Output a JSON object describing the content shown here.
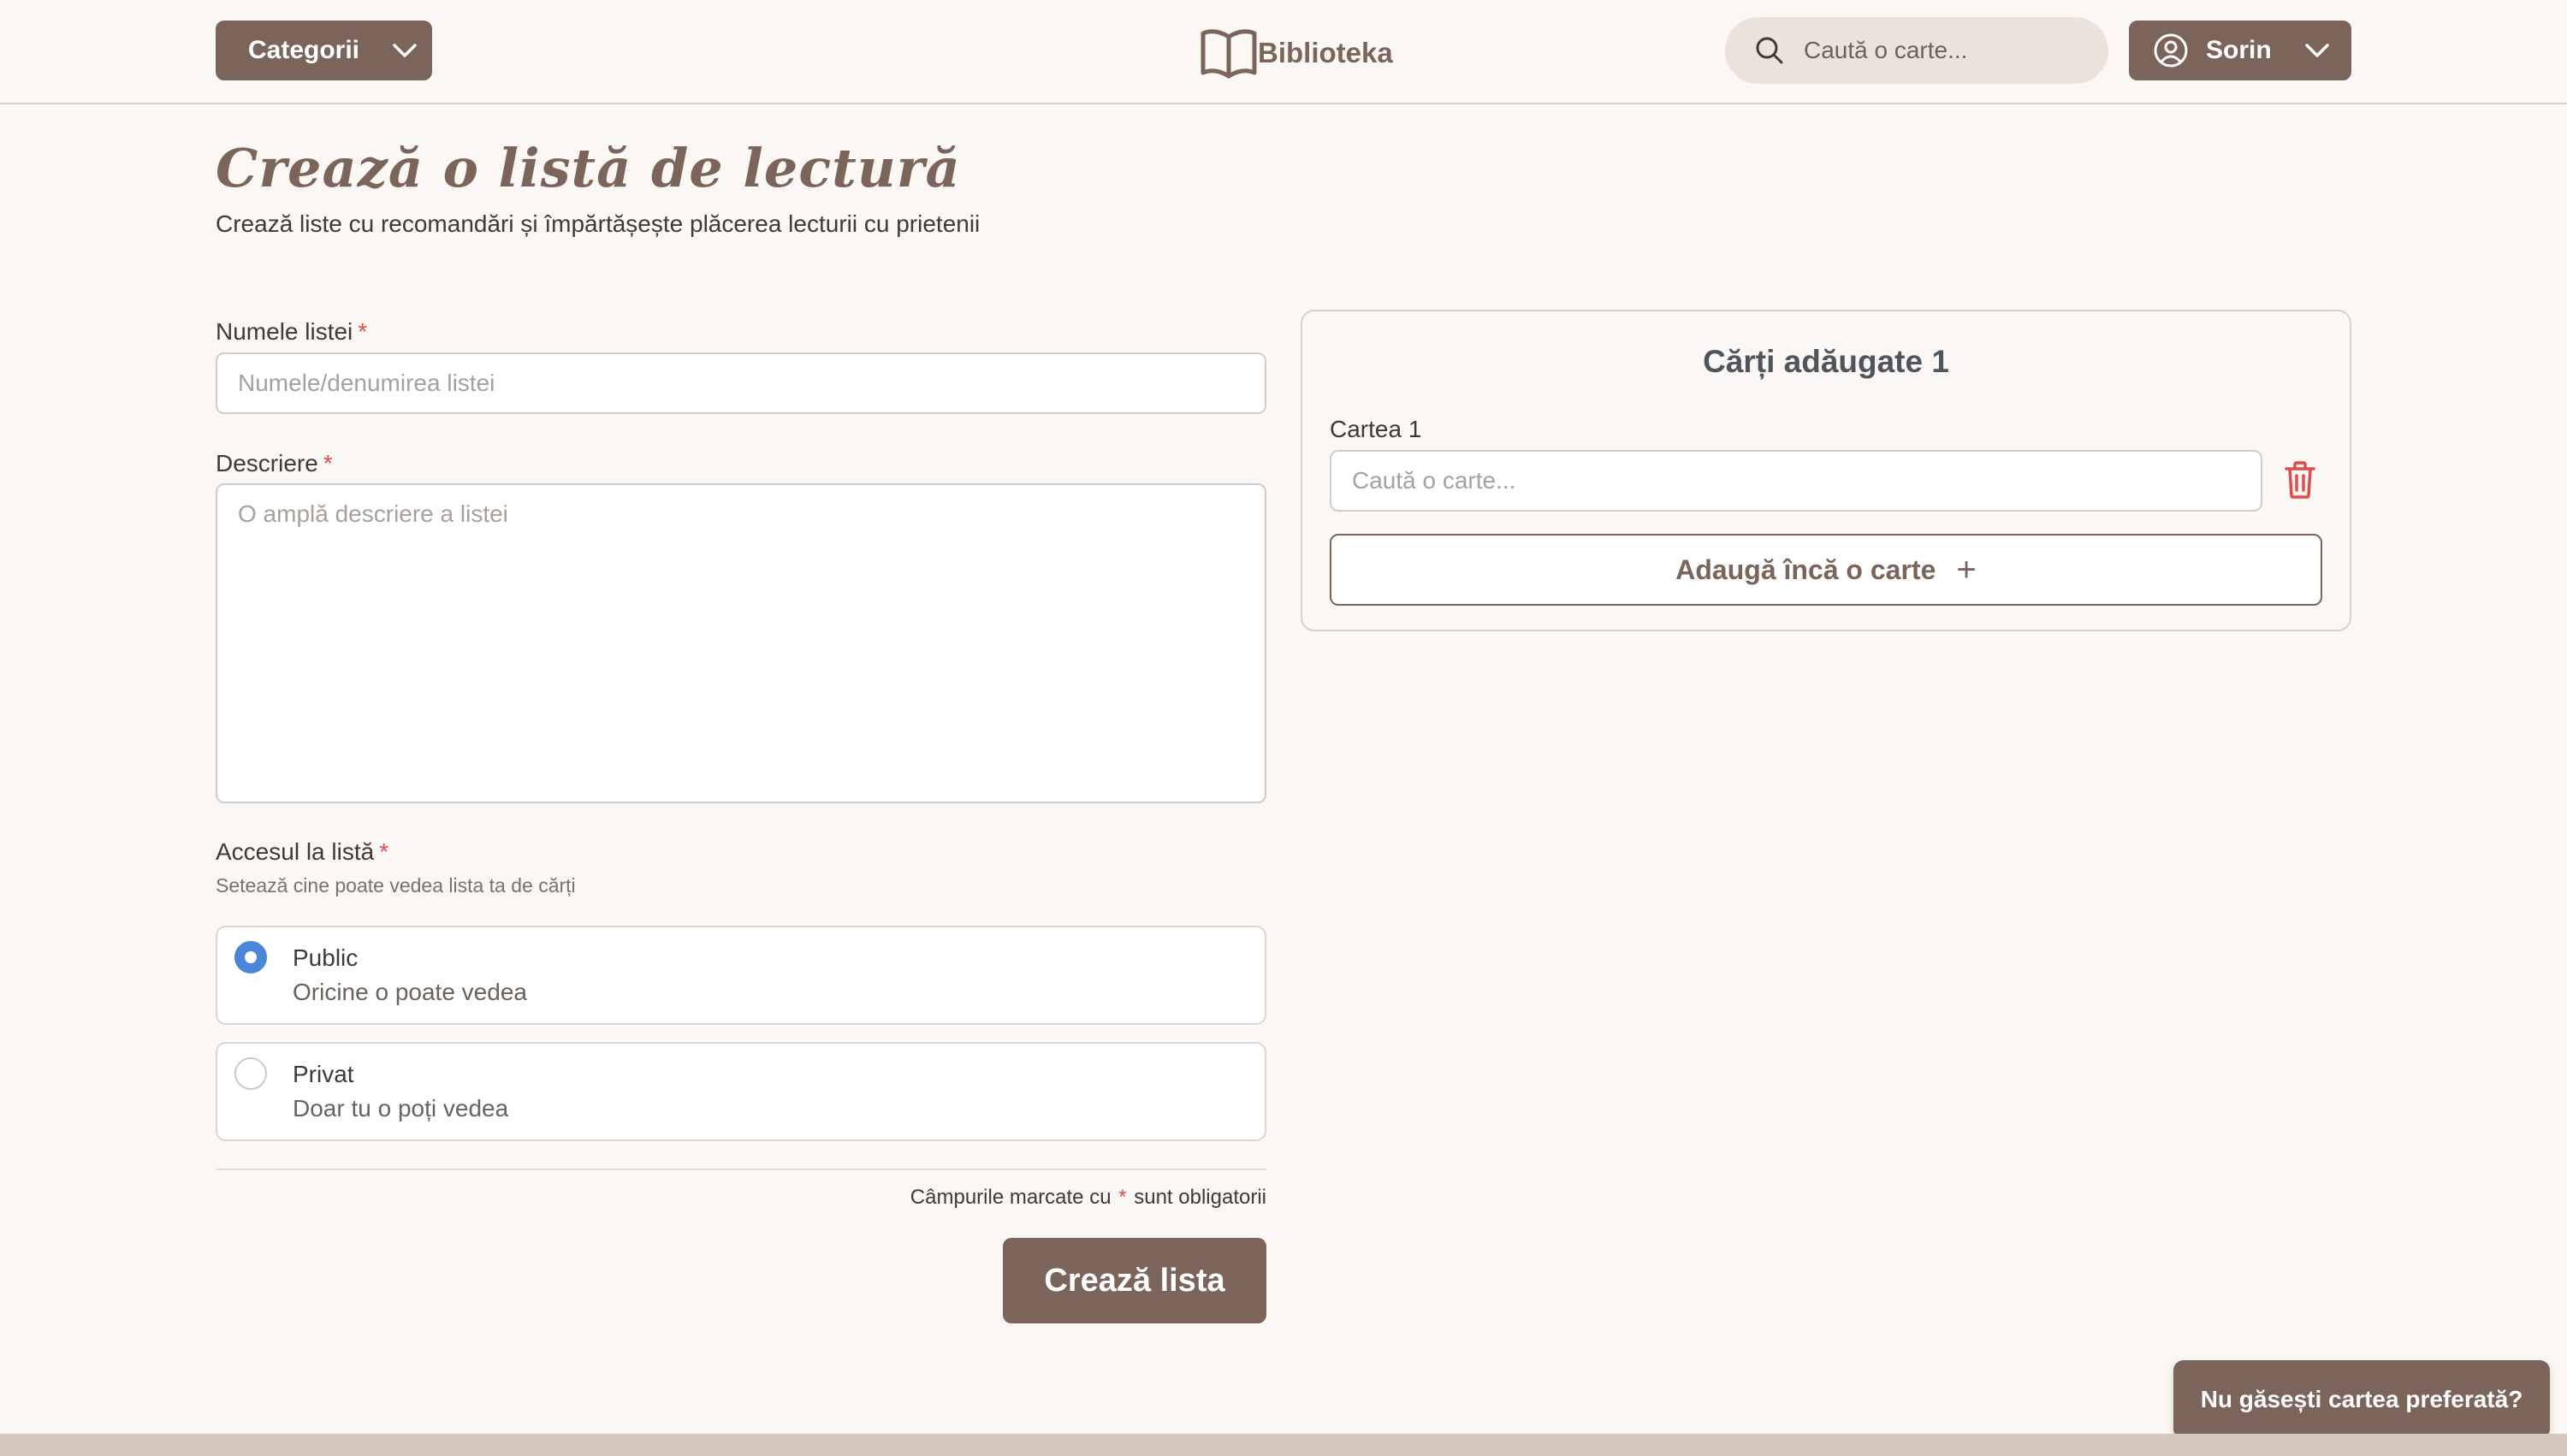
{
  "header": {
    "categories_label": "Categorii",
    "logo_text": "Biblioteka",
    "search_placeholder": "Caută o carte...",
    "user_name": "Sorin"
  },
  "page": {
    "title": "Crează o listă de lectură",
    "subtitle": "Crează liste cu recomandări și împărtășește plăcerea lecturii cu prietenii"
  },
  "form": {
    "name_label": "Numele listei",
    "name_placeholder": "Numele/denumirea listei",
    "description_label": "Descriere",
    "description_placeholder": "O amplă descriere a listei",
    "access_label": "Accesul la listă",
    "access_hint": "Setează cine poate vedea lista ta de cărți",
    "access_options": [
      {
        "title": "Public",
        "description": "Oricine o poate vedea",
        "selected": true
      },
      {
        "title": "Privat",
        "description": "Doar tu o poți vedea",
        "selected": false
      }
    ],
    "required_marker": "*",
    "required_note_prefix": "Câmpurile marcate cu",
    "required_note_suffix": "sunt obligatorii",
    "submit_label": "Crează lista"
  },
  "books_panel": {
    "title": "Cărți adăugate 1",
    "book_label": "Cartea 1",
    "book_search_placeholder": "Caută o carte...",
    "add_button_label": "Adaugă încă o carte",
    "add_icon": "+"
  },
  "help_button_label": "Nu găsești cartea preferată?",
  "colors": {
    "brand": "#7b655b",
    "background": "#fbf7f4",
    "accent_radio": "#4a86d8",
    "danger": "#e24b4b"
  }
}
